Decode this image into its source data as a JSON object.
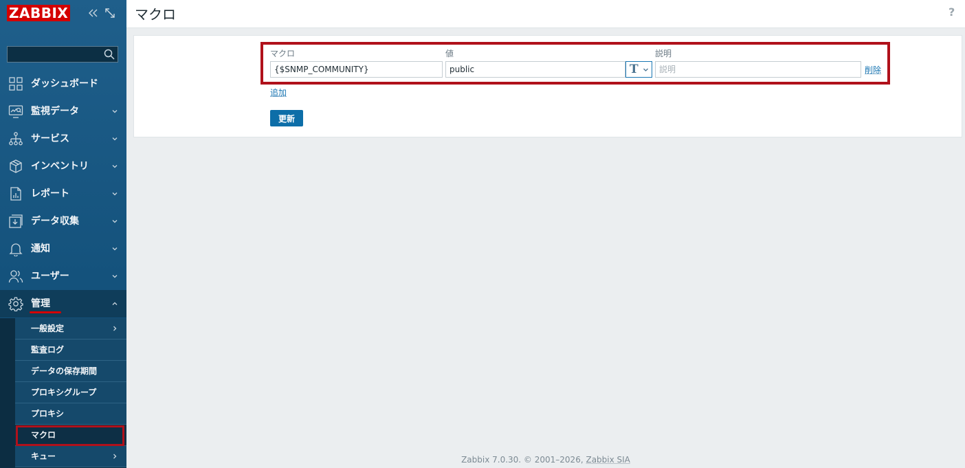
{
  "sidebar": {
    "logo": "ZABBIX",
    "collapse_icon": "double-chevron-left-icon",
    "kiosk_icon": "expand-icon",
    "search": {
      "value": "",
      "placeholder": ""
    },
    "menu": [
      {
        "label": "ダッシュボード",
        "icon": "dashboard-icon",
        "has_chevron": false
      },
      {
        "label": "監視データ",
        "icon": "monitoring-icon",
        "has_chevron": true
      },
      {
        "label": "サービス",
        "icon": "services-icon",
        "has_chevron": true
      },
      {
        "label": "インベントリ",
        "icon": "inventory-icon",
        "has_chevron": true
      },
      {
        "label": "レポート",
        "icon": "reports-icon",
        "has_chevron": true
      },
      {
        "label": "データ収集",
        "icon": "data-collection-icon",
        "has_chevron": true
      },
      {
        "label": "通知",
        "icon": "alerts-icon",
        "has_chevron": true
      },
      {
        "label": "ユーザー",
        "icon": "users-icon",
        "has_chevron": true
      },
      {
        "label": "管理",
        "icon": "administration-icon",
        "has_chevron": true,
        "expanded": true
      }
    ],
    "submenu": [
      {
        "label": "一般設定",
        "has_chevron": true
      },
      {
        "label": "監査ログ",
        "has_chevron": false
      },
      {
        "label": "データの保存期間",
        "has_chevron": false
      },
      {
        "label": "プロキシグループ",
        "has_chevron": false
      },
      {
        "label": "プロキシ",
        "has_chevron": false
      },
      {
        "label": "マクロ",
        "has_chevron": false,
        "selected": true
      },
      {
        "label": "キュー",
        "has_chevron": true
      }
    ]
  },
  "header": {
    "title": "マクロ",
    "help": "?"
  },
  "macros_form": {
    "columns": {
      "macro": "マクロ",
      "value": "値",
      "description": "説明"
    },
    "rows": [
      {
        "macro": "{$SNMP_COMMUNITY}",
        "value": "public",
        "value_type_icon": "T",
        "description": "",
        "description_placeholder": "説明",
        "remove_label": "削除"
      }
    ],
    "add_label": "追加",
    "update_label": "更新"
  },
  "footer": {
    "text": "Zabbix 7.0.30. © 2001–2026, ",
    "link": "Zabbix SIA"
  },
  "colors": {
    "sidebar_bg": "#1f5f8b",
    "accent": "#0d6ea8",
    "highlight": "#b0111b",
    "logo_red": "#d40000"
  }
}
